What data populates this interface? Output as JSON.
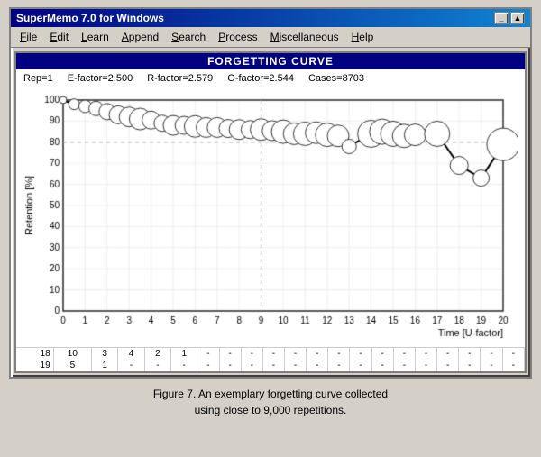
{
  "window": {
    "title": "SuperMemo 7.0 for Windows",
    "minimize_label": "_",
    "maximize_label": "▲"
  },
  "menu": {
    "items": [
      {
        "label": "File",
        "underline_index": 0
      },
      {
        "label": "Edit",
        "underline_index": 0
      },
      {
        "label": "Learn",
        "underline_index": 0
      },
      {
        "label": "Append",
        "underline_index": 0
      },
      {
        "label": "Search",
        "underline_index": 0
      },
      {
        "label": "Process",
        "underline_index": 0
      },
      {
        "label": "Miscellaneous",
        "underline_index": 0
      },
      {
        "label": "Help",
        "underline_index": 0
      }
    ]
  },
  "chart": {
    "title": "FORGETTING CURVE",
    "stats": {
      "rep": "Rep=1",
      "efactor": "E-factor=2.500",
      "rfactor": "R-factor=2.579",
      "ofactor": "O-factor=2.544",
      "cases": "Cases=8703"
    },
    "y_axis_label": "Retention [%]",
    "x_axis_label": "Time [U-factor]",
    "y_ticks": [
      0,
      10,
      20,
      30,
      40,
      50,
      60,
      70,
      80,
      90,
      100
    ],
    "x_ticks": [
      0,
      1,
      2,
      3,
      4,
      5,
      6,
      7,
      8,
      9,
      10,
      11,
      12,
      13,
      14,
      15,
      16,
      17,
      18,
      19,
      20
    ]
  },
  "table": {
    "rows": [
      [
        "18",
        "10",
        "3",
        "4",
        "2",
        "1",
        "-",
        "-",
        "-",
        "-",
        "-",
        "-",
        "-",
        "-",
        "-",
        "-",
        "-",
        "-",
        "-",
        "-",
        "-"
      ],
      [
        "19",
        "5",
        "1",
        "-",
        "-",
        "-",
        "-",
        "-",
        "-",
        "-",
        "-",
        "-",
        "-",
        "-",
        "-",
        "-",
        "-",
        "-",
        "-",
        "-",
        "-"
      ]
    ]
  },
  "caption": "Figure 7. An exemplary forgetting curve collected\nusing close to 9,000 repetitions."
}
